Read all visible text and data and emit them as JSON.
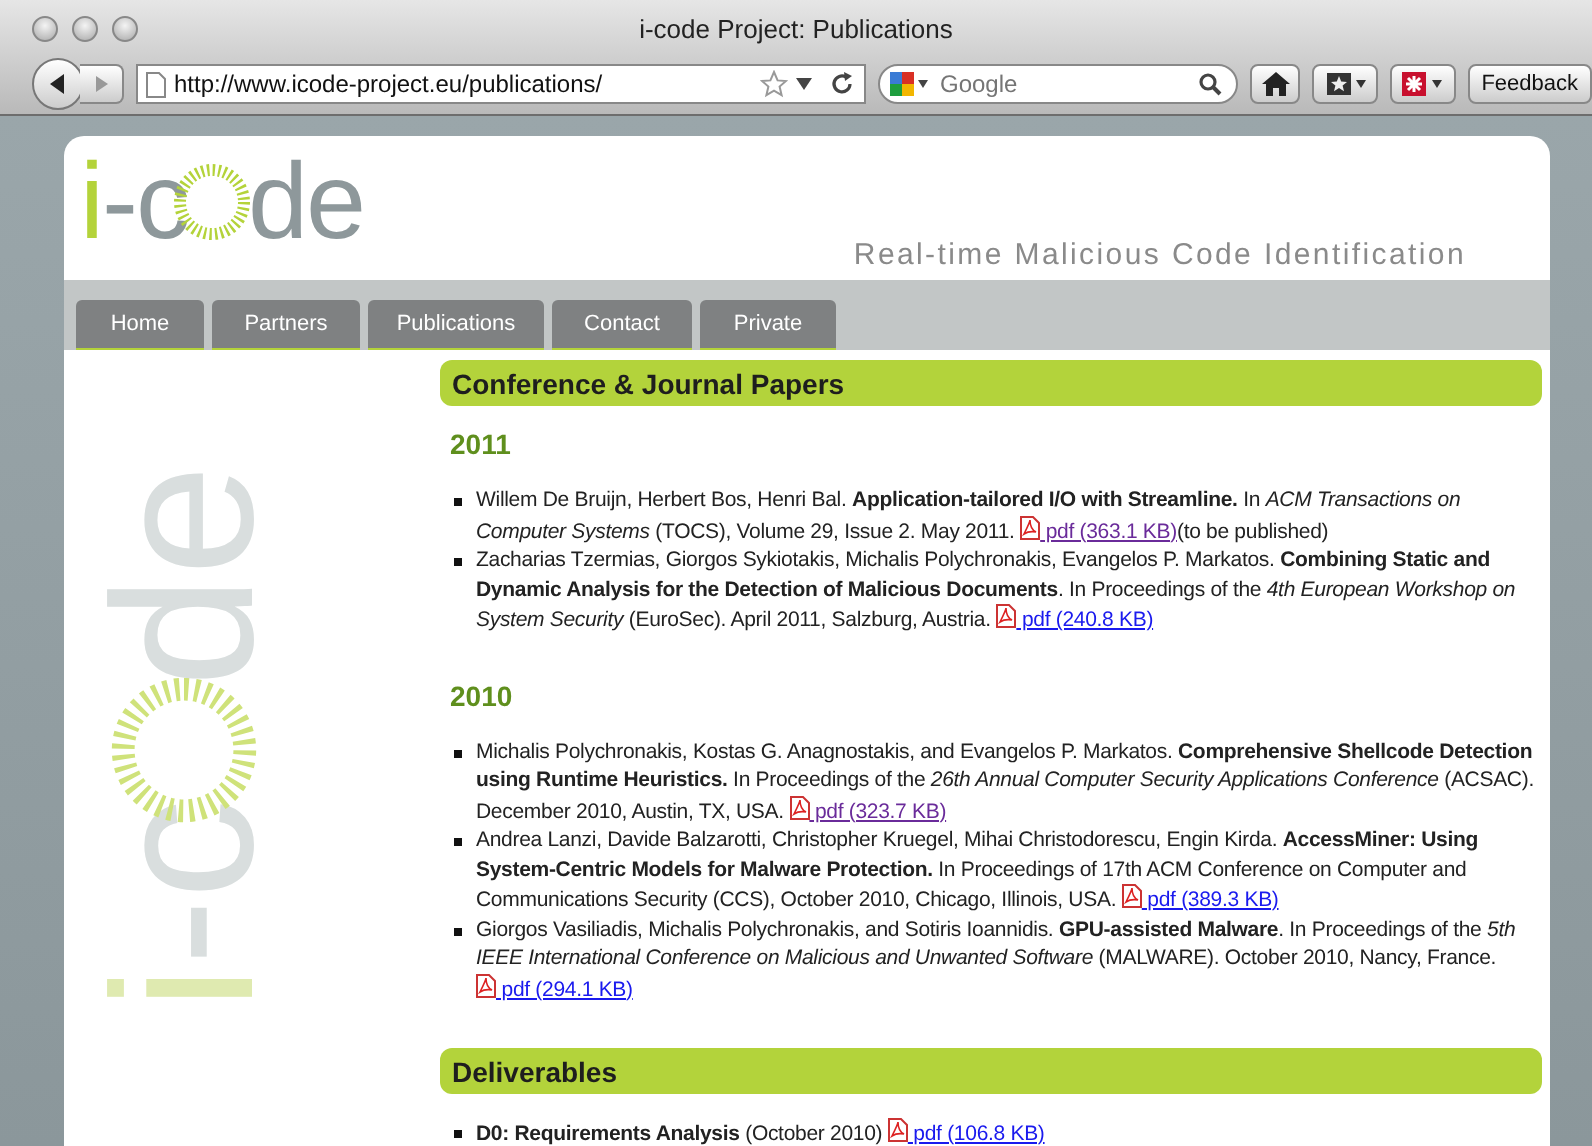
{
  "window": {
    "title": "i-code Project: Publications"
  },
  "toolbar": {
    "url": "http://www.icode-project.eu/publications/",
    "search": {
      "placeholder": "Google"
    },
    "feedback": "Feedback"
  },
  "site": {
    "logo": {
      "before": "i-c",
      "after": "de"
    },
    "tagline": "Real-time Malicious Code Identification",
    "nav": [
      "Home",
      "Partners",
      "Publications",
      "Contact",
      "Private"
    ],
    "side_logo": {
      "before": "i-c",
      "after": "de"
    }
  },
  "sections": [
    {
      "title": "Conference & Journal Papers",
      "groups": [
        {
          "year": "2011",
          "entries": [
            {
              "text": "Willem De Bruijn, Herbert Bos, Henri Bal. **Application-tailored I/O with Streamline.** In *ACM Transactions on Computer Systems* (TOCS), Volume 29, Issue 2. May 2011.",
              "link": "pdf (363.1 KB)",
              "visited": true,
              "note": "(to be published)"
            },
            {
              "text": "Zacharias Tzermias, Giorgos Sykiotakis, Michalis Polychronakis, Evangelos P. Markatos. **Combining Static and Dynamic Analysis for the Detection of Malicious Documents**. In Proceedings of the *4th European Workshop on System Security* (EuroSec). April 2011, Salzburg, Austria.",
              "link": "pdf (240.8 KB)",
              "visited": false
            }
          ]
        },
        {
          "year": "2010",
          "entries": [
            {
              "text": "Michalis Polychronakis, Kostas G. Anagnostakis, and Evangelos P. Markatos. **Comprehensive Shellcode Detection using Runtime Heuristics.** In Proceedings of the *26th Annual Computer Security Applications Conference* (ACSAC). December 2010, Austin, TX, USA.",
              "link": "pdf (323.7 KB)",
              "visited": true
            },
            {
              "text": "Andrea Lanzi, Davide Balzarotti, Christopher Kruegel, Mihai Christodorescu, Engin Kirda. **AccessMiner: Using System-Centric Models for Malware Protection.** In Proceedings of 17th ACM Conference on Computer and Communications Security (CCS), October 2010, Chicago, Illinois, USA.",
              "link": "pdf (389.3 KB)",
              "visited": false
            },
            {
              "text": "Giorgos Vasiliadis, Michalis Polychronakis, and Sotiris Ioannidis. **GPU-assisted Malware**. In Proceedings of the *5th IEEE International Conference on Malicious and Unwanted Software* (MALWARE). October 2010, Nancy, France.",
              "link": "pdf (294.1 KB)",
              "visited": false
            }
          ]
        }
      ]
    },
    {
      "title": "Deliverables",
      "groups": [
        {
          "entries": [
            {
              "text": "**D0: Requirements Analysis** (October 2010)",
              "link": "pdf (106.8 KB)",
              "visited": false
            }
          ]
        }
      ]
    }
  ]
}
